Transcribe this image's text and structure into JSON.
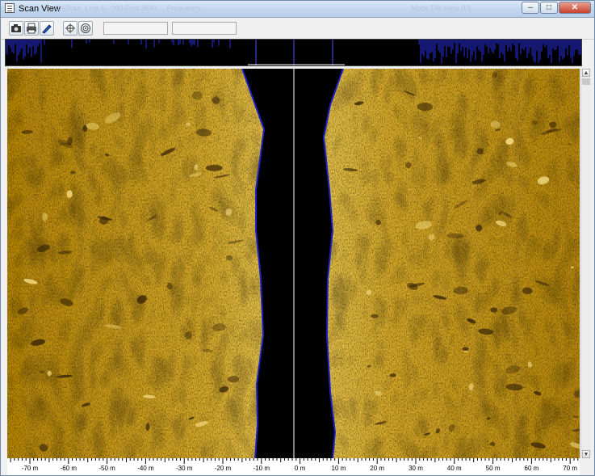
{
  "window": {
    "title": "Scan View",
    "background_title_fragment_left": "...C:\\Scan_Line 6_ 000 Fwd.SON ... Frequency...",
    "background_title_fragment_right": "Mock Tile View 0.1",
    "controls": {
      "minimize": "–",
      "maximize": "□",
      "close": "✕"
    }
  },
  "toolbar": {
    "buttons": [
      {
        "id": "camera",
        "icon": "camera-icon"
      },
      {
        "id": "print",
        "icon": "printer-icon"
      },
      {
        "id": "pen",
        "icon": "pen-icon"
      },
      {
        "id": "target",
        "icon": "crosshair-icon"
      },
      {
        "id": "zoom",
        "icon": "concentric-circles-icon"
      }
    ],
    "field1_value": "",
    "field2_value": ""
  },
  "scale": {
    "unit": "m",
    "tick_labels": [
      "-70 m",
      "-60 m",
      "-50 m",
      "-40 m",
      "-30 m",
      "-20 m",
      "-10 m",
      "0 m",
      "10 m",
      "20 m",
      "30 m",
      "40 m",
      "50 m",
      "60 m",
      "70 m"
    ]
  },
  "colors": {
    "sonar_sand": "#c99a1c",
    "sonar_dark": "#5a3f07",
    "water_column": "#000000",
    "bottom_line": "#1d22c8",
    "center_line": "#ffffff"
  }
}
